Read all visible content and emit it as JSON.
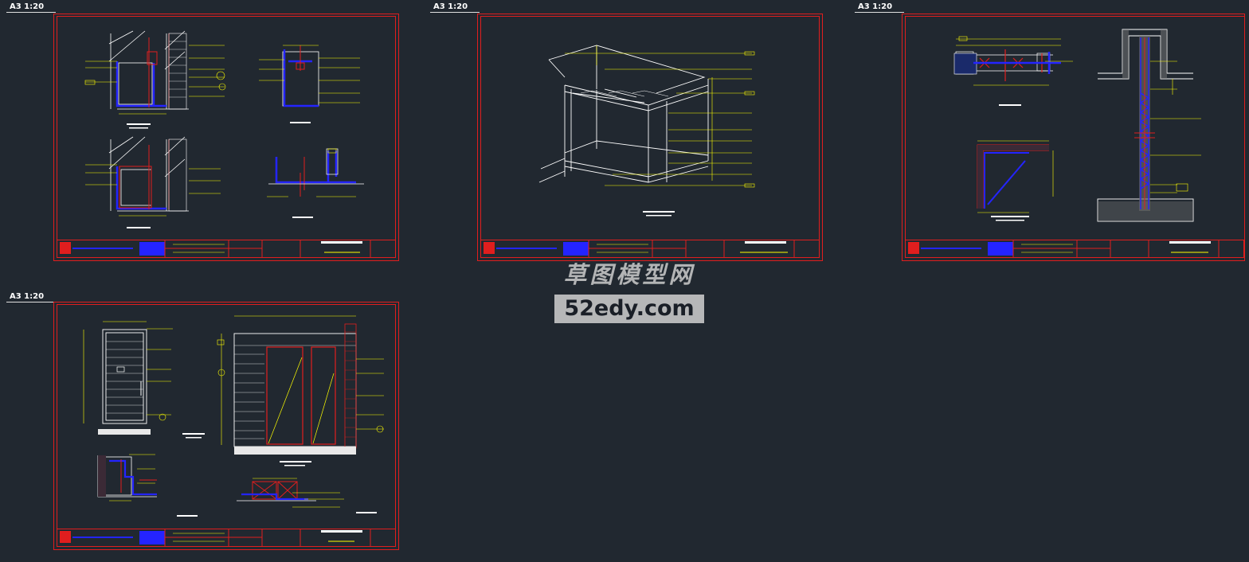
{
  "sheets": [
    {
      "label": "A3 1:20"
    },
    {
      "label": "A3 1:20"
    },
    {
      "label": "A3 1:20"
    },
    {
      "label": "A3 1:20"
    }
  ],
  "watermark": {
    "brand": "草图模型网",
    "site": "52edy.com"
  },
  "colors": {
    "background": "#212830",
    "frame": "#e01e1e",
    "linework": "#ffffff",
    "dimension": "#ffff00",
    "fill": "#2424ff",
    "hatch": "#33c8ff"
  }
}
